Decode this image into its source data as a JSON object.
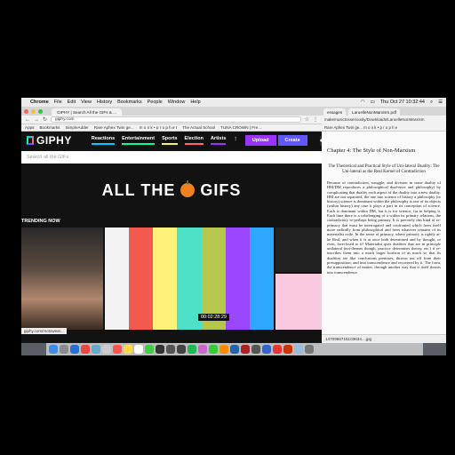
{
  "menubar": {
    "app": "Chrome",
    "items": [
      "File",
      "Edit",
      "View",
      "History",
      "Bookmarks",
      "People",
      "Window",
      "Help"
    ],
    "clock": "Thu Oct 27  10:32:44"
  },
  "browser": {
    "tab_title": "GIPHY | Search All the GIFs & ...",
    "url": "giphy.com",
    "bookmarks": [
      "Apps",
      "Bookmarks",
      "SimpleAdder",
      "Rare Aphex Twin ge...",
      "m o n k • p r o p h e t",
      "The Actual School",
      "TUNA CROWN | Fre..."
    ]
  },
  "giphy": {
    "logo": "GIPHY",
    "nav": [
      "Reactions",
      "Entertainment",
      "Sports",
      "Election",
      "Artists"
    ],
    "upload": "Upload",
    "create": "Create",
    "search_placeholder": "Search all the GIFs",
    "banner_left": "ALL THE",
    "banner_right": "GIFS",
    "trending": "TRENDING NOW",
    "timecode": "00:02:28:29",
    "status_url": "giphy.com/motowear..."
  },
  "pdf": {
    "tabs": [
      "essages",
      "LaruelleNonMarxism.pdf"
    ],
    "url": "makemusictosseriously/Downloads/LaruelleNonMarxism",
    "bookmarks": "Rare Aphex Twin ge...   m o n k • p r o p h e",
    "chapter": "Chapter 4: The Style of Non-Marxism",
    "section_title": "The Theoretical and Practical Style of Uni-lateral Duality: The Uni-lateral as the Real Kernel of Contradiction",
    "body": "Because of contradiction, struggle, and division in some duality of HM/DM reproduces a philosophical dual-ence and philosophy) by complicating that duality each aspect of the duality into a new duality. HM are not separated, the one into science of history a philosophy (or history) science is dominant within the philosophy is one of its objects (within history) any case it plays a part in its conception of science. Each is dominant within DM, but it is for science, far in helping it. Each time there is a cobelonging of a within its primary relations, the contradictory re-perhaps being primary. It is precisely this kind of re-primacy that must be interrogated and confronted which frees itself more radically from philosophical and frees whatever remains of its materialist exile. In the sense of primacy, where primacy is rightly at-he Real, and when it is at once both determined and by thought, or even, foreclosed to it! Materialist ques dualities that are in principle unilateral (not-themes though, practice determines theory, etc.) it re-inscribes them into a much larger horizon of as much so that its dualities are like conclusions premises, thrown out off from their presupposition; and into transcendence and recovered by it. The form, the transcendence of matter, through another way that it itself thrusts into transcendence.",
    "download": "1470996715103634....jpg"
  }
}
